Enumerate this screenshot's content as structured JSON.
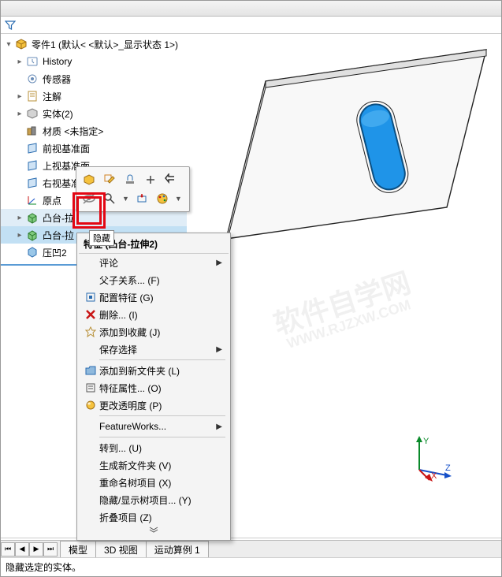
{
  "header": {
    "part_title": "零件1  (默认< <默认>_显示状态 1>)"
  },
  "tree": {
    "items": [
      {
        "icon": "history",
        "label": "History",
        "exp": "+"
      },
      {
        "icon": "sensor",
        "label": "传感器",
        "exp": ""
      },
      {
        "icon": "note",
        "label": "注解",
        "exp": "+"
      },
      {
        "icon": "body",
        "label": "实体(2)",
        "exp": "+"
      },
      {
        "icon": "material",
        "label": "材质 <未指定>",
        "exp": ""
      },
      {
        "icon": "plane",
        "label": "前视基准面",
        "exp": ""
      },
      {
        "icon": "plane",
        "label": "上视基准面",
        "exp": ""
      },
      {
        "icon": "plane",
        "label": "右视基准面",
        "exp": ""
      },
      {
        "icon": "origin",
        "label": "原点",
        "exp": ""
      },
      {
        "icon": "extrude",
        "label": "凸台-拉",
        "exp": "+",
        "hover": true
      },
      {
        "icon": "extrude",
        "label": "凸台-拉",
        "exp": "+",
        "selected": true
      },
      {
        "icon": "cavity",
        "label": "压凹2",
        "exp": ""
      }
    ]
  },
  "tooltip": {
    "text": "隐藏"
  },
  "context_menu": {
    "header": "特征 (凸台-拉伸2)",
    "items": [
      {
        "label": "评论",
        "sub": true
      },
      {
        "label": "父子关系... (F)"
      },
      {
        "icon": "config",
        "label": "配置特征 (G)"
      },
      {
        "icon": "delete",
        "label": "删除... (I)"
      },
      {
        "icon": "fav",
        "label": "添加到收藏 (J)"
      },
      {
        "label": "保存选择",
        "sub": true
      },
      {
        "sep": true
      },
      {
        "icon": "folder",
        "label": "添加到新文件夹 (L)"
      },
      {
        "icon": "props",
        "label": "特征属性... (O)"
      },
      {
        "icon": "transp",
        "label": "更改透明度 (P)"
      },
      {
        "sep": true
      },
      {
        "label": "FeatureWorks...",
        "sub": true
      },
      {
        "sep": true
      },
      {
        "label": "转到... (U)"
      },
      {
        "label": "生成新文件夹 (V)"
      },
      {
        "label": "重命名树项目 (X)"
      },
      {
        "label": "隐藏/显示树项目... (Y)"
      },
      {
        "label": "折叠项目 (Z)"
      }
    ]
  },
  "tabs": {
    "items": [
      "模型",
      "3D 视图",
      "运动算例 1"
    ]
  },
  "status": {
    "text": "隐藏选定的实体。"
  },
  "watermark": {
    "line1": "软件自学网",
    "line2": "WWW.RJZXW.COM"
  },
  "triad": {
    "x": "X",
    "y": "Y",
    "z": "Z"
  }
}
